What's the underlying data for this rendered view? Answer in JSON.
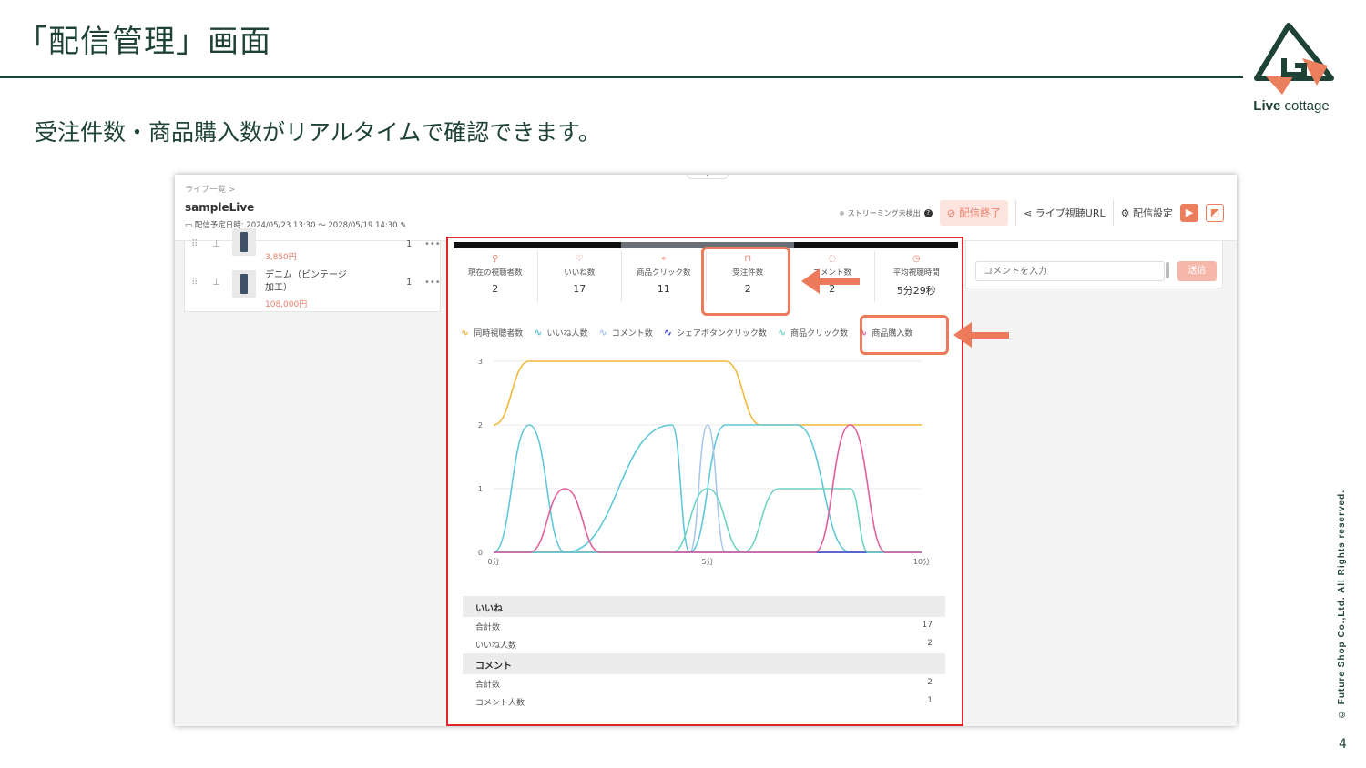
{
  "slide": {
    "title": "「配信管理」画面",
    "subtitle": "受注件数・商品購入数がリアルタイムで確認できます。",
    "logo_bold": "Live",
    "logo_rest": " cottage",
    "copyright": "© Future Shop Co.,Ltd. All Rights reserved.",
    "page_number": "4",
    "colors": {
      "brand_dark": "#1f4237",
      "accent": "#ed7a5a",
      "highlight_red": "#e0252b"
    }
  },
  "app": {
    "breadcrumb": "ライブ一覧  >",
    "live_name": "sampleLive",
    "schedule": "配信予定日時: 2024/05/23 13:30 〜 2028/05/19 14:30",
    "stream_status": "ストリーミング未検出",
    "help_icon": "?",
    "end_button": "配信終了",
    "watch_url_button": "ライブ視聴URL",
    "settings_button": "配信設定",
    "products": [
      {
        "name": "",
        "price": "3,850円",
        "qty": "1"
      },
      {
        "name": "デニム（ビンテージ加工）",
        "name_line1": "デニム（ビンテージ",
        "name_line2": "加工）",
        "price": "108,000円",
        "qty": "1"
      }
    ],
    "comment_placeholder": "コメントを入力",
    "send_button": "送信"
  },
  "stats": [
    {
      "icon": "viewer-icon",
      "label": "現在の視聴者数",
      "value": "2"
    },
    {
      "icon": "heart-icon",
      "label": "いいね数",
      "value": "17"
    },
    {
      "icon": "click-icon",
      "label": "商品クリック数",
      "value": "11"
    },
    {
      "icon": "bag-icon",
      "label": "受注件数",
      "value": "2"
    },
    {
      "icon": "comment-icon",
      "label": "コメント数",
      "value": "2"
    },
    {
      "icon": "clock-icon",
      "label": "平均視聴時間",
      "value": "5分29秒"
    }
  ],
  "chart_data": {
    "type": "line",
    "x_ticks": [
      "0分",
      "5分",
      "10分"
    ],
    "xlim": [
      0,
      12
    ],
    "ylim": [
      0,
      3
    ],
    "y_ticks": [
      "0",
      "1",
      "2",
      "3"
    ],
    "grid": true,
    "legend_position": "top",
    "series": [
      {
        "name": "同時視聴者数",
        "color": "#f0b93a",
        "x": [
          0,
          1,
          6.5,
          7.5,
          12
        ],
        "y": [
          2,
          3,
          3,
          2,
          2
        ]
      },
      {
        "name": "いいね人数",
        "color": "#5ec8d8",
        "x": [
          0,
          1,
          2,
          5,
          5.5,
          6.5,
          8.5,
          10,
          12
        ],
        "y": [
          0,
          2,
          0,
          2,
          0,
          2,
          2,
          0,
          0
        ]
      },
      {
        "name": "コメント数",
        "color": "#a9c7e8",
        "x": [
          0,
          5.5,
          6,
          6.5,
          12
        ],
        "y": [
          0,
          0,
          2,
          0,
          0
        ]
      },
      {
        "name": "シェアボタンクリック数",
        "color": "#3a3fc4",
        "x": [
          0,
          9,
          10,
          12
        ],
        "y": [
          0,
          0,
          0,
          0
        ]
      },
      {
        "name": "商品クリック数",
        "color": "#6fd3c4",
        "x": [
          0,
          5,
          6,
          7,
          8,
          8.5,
          10,
          10.5,
          12
        ],
        "y": [
          0,
          0,
          1,
          0,
          1,
          1,
          1,
          0,
          0
        ]
      },
      {
        "name": "商品購入数",
        "color": "#e0609e",
        "x": [
          0,
          1,
          2,
          3,
          9,
          10,
          11,
          12
        ],
        "y": [
          0,
          0,
          1,
          0,
          0,
          2,
          0,
          0
        ]
      }
    ]
  },
  "summary": {
    "likes": {
      "heading": "いいね",
      "total_label": "合計数",
      "total": "17",
      "users_label": "いいね人数",
      "users": "2"
    },
    "comments": {
      "heading": "コメント",
      "total_label": "合計数",
      "total": "2",
      "users_label": "コメント人数",
      "users": "1"
    }
  }
}
